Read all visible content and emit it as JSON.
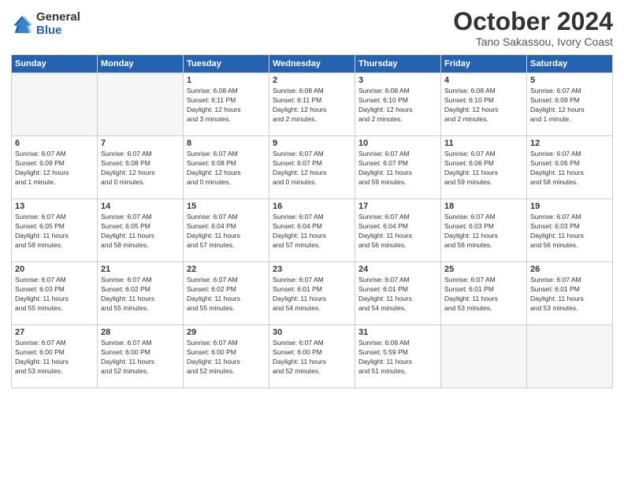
{
  "logo": {
    "general": "General",
    "blue": "Blue"
  },
  "title": "October 2024",
  "location": "Tano Sakassou, Ivory Coast",
  "headers": [
    "Sunday",
    "Monday",
    "Tuesday",
    "Wednesday",
    "Thursday",
    "Friday",
    "Saturday"
  ],
  "weeks": [
    [
      {
        "day": "",
        "info": ""
      },
      {
        "day": "",
        "info": ""
      },
      {
        "day": "1",
        "info": "Sunrise: 6:08 AM\nSunset: 6:11 PM\nDaylight: 12 hours\nand 3 minutes."
      },
      {
        "day": "2",
        "info": "Sunrise: 6:08 AM\nSunset: 6:11 PM\nDaylight: 12 hours\nand 2 minutes."
      },
      {
        "day": "3",
        "info": "Sunrise: 6:08 AM\nSunset: 6:10 PM\nDaylight: 12 hours\nand 2 minutes."
      },
      {
        "day": "4",
        "info": "Sunrise: 6:08 AM\nSunset: 6:10 PM\nDaylight: 12 hours\nand 2 minutes."
      },
      {
        "day": "5",
        "info": "Sunrise: 6:07 AM\nSunset: 6:09 PM\nDaylight: 12 hours\nand 1 minute."
      }
    ],
    [
      {
        "day": "6",
        "info": "Sunrise: 6:07 AM\nSunset: 6:09 PM\nDaylight: 12 hours\nand 1 minute."
      },
      {
        "day": "7",
        "info": "Sunrise: 6:07 AM\nSunset: 6:08 PM\nDaylight: 12 hours\nand 0 minutes."
      },
      {
        "day": "8",
        "info": "Sunrise: 6:07 AM\nSunset: 6:08 PM\nDaylight: 12 hours\nand 0 minutes."
      },
      {
        "day": "9",
        "info": "Sunrise: 6:07 AM\nSunset: 6:07 PM\nDaylight: 12 hours\nand 0 minutes."
      },
      {
        "day": "10",
        "info": "Sunrise: 6:07 AM\nSunset: 6:07 PM\nDaylight: 11 hours\nand 59 minutes."
      },
      {
        "day": "11",
        "info": "Sunrise: 6:07 AM\nSunset: 6:06 PM\nDaylight: 11 hours\nand 59 minutes."
      },
      {
        "day": "12",
        "info": "Sunrise: 6:07 AM\nSunset: 6:06 PM\nDaylight: 11 hours\nand 58 minutes."
      }
    ],
    [
      {
        "day": "13",
        "info": "Sunrise: 6:07 AM\nSunset: 6:05 PM\nDaylight: 11 hours\nand 58 minutes."
      },
      {
        "day": "14",
        "info": "Sunrise: 6:07 AM\nSunset: 6:05 PM\nDaylight: 11 hours\nand 58 minutes."
      },
      {
        "day": "15",
        "info": "Sunrise: 6:07 AM\nSunset: 6:04 PM\nDaylight: 11 hours\nand 57 minutes."
      },
      {
        "day": "16",
        "info": "Sunrise: 6:07 AM\nSunset: 6:04 PM\nDaylight: 11 hours\nand 57 minutes."
      },
      {
        "day": "17",
        "info": "Sunrise: 6:07 AM\nSunset: 6:04 PM\nDaylight: 11 hours\nand 56 minutes."
      },
      {
        "day": "18",
        "info": "Sunrise: 6:07 AM\nSunset: 6:03 PM\nDaylight: 11 hours\nand 56 minutes."
      },
      {
        "day": "19",
        "info": "Sunrise: 6:07 AM\nSunset: 6:03 PM\nDaylight: 11 hours\nand 56 minutes."
      }
    ],
    [
      {
        "day": "20",
        "info": "Sunrise: 6:07 AM\nSunset: 6:03 PM\nDaylight: 11 hours\nand 55 minutes."
      },
      {
        "day": "21",
        "info": "Sunrise: 6:07 AM\nSunset: 6:02 PM\nDaylight: 11 hours\nand 55 minutes."
      },
      {
        "day": "22",
        "info": "Sunrise: 6:07 AM\nSunset: 6:02 PM\nDaylight: 11 hours\nand 55 minutes."
      },
      {
        "day": "23",
        "info": "Sunrise: 6:07 AM\nSunset: 6:01 PM\nDaylight: 11 hours\nand 54 minutes."
      },
      {
        "day": "24",
        "info": "Sunrise: 6:07 AM\nSunset: 6:01 PM\nDaylight: 11 hours\nand 54 minutes."
      },
      {
        "day": "25",
        "info": "Sunrise: 6:07 AM\nSunset: 6:01 PM\nDaylight: 11 hours\nand 53 minutes."
      },
      {
        "day": "26",
        "info": "Sunrise: 6:07 AM\nSunset: 6:01 PM\nDaylight: 11 hours\nand 53 minutes."
      }
    ],
    [
      {
        "day": "27",
        "info": "Sunrise: 6:07 AM\nSunset: 6:00 PM\nDaylight: 11 hours\nand 53 minutes."
      },
      {
        "day": "28",
        "info": "Sunrise: 6:07 AM\nSunset: 6:00 PM\nDaylight: 11 hours\nand 52 minutes."
      },
      {
        "day": "29",
        "info": "Sunrise: 6:07 AM\nSunset: 6:00 PM\nDaylight: 11 hours\nand 52 minutes."
      },
      {
        "day": "30",
        "info": "Sunrise: 6:07 AM\nSunset: 6:00 PM\nDaylight: 11 hours\nand 52 minutes."
      },
      {
        "day": "31",
        "info": "Sunrise: 6:08 AM\nSunset: 5:59 PM\nDaylight: 11 hours\nand 51 minutes."
      },
      {
        "day": "",
        "info": ""
      },
      {
        "day": "",
        "info": ""
      }
    ]
  ]
}
